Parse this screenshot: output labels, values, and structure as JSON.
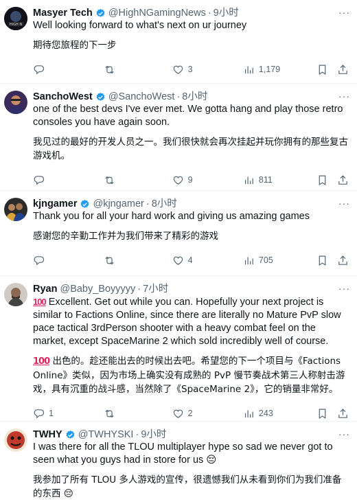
{
  "accent": "#1d9bf0",
  "tweets": [
    {
      "name": "Masyer Tech",
      "verified": true,
      "handle": "@HighNGamingNews",
      "time": "9小时",
      "text": "Well looking forward to what's next on ur journey",
      "translation": "期待您旅程的下一步",
      "replies": "",
      "retweets": "",
      "likes": "3",
      "views": "1,179"
    },
    {
      "name": "SanchoWest",
      "verified": true,
      "handle": "@SanchoWest",
      "time": "8小时",
      "text": "one of the best devs I've ever met. We gotta hang and play those retro consoles you have again soon.",
      "translation": "我见过的最好的开发人员之一。我们很快就会再次挂起并玩你拥有的那些复古游戏机。",
      "replies": "",
      "retweets": "",
      "likes": "9",
      "views": "811"
    },
    {
      "name": "kjngamer",
      "verified": true,
      "handle": "@kjngamer",
      "time": "8小时",
      "text": "Thank you for all your hard work and giving us amazing games",
      "translation": "感谢您的辛勤工作并为我们带来了精彩的游戏",
      "replies": "",
      "retweets": "",
      "likes": "4",
      "views": "705"
    },
    {
      "name": "Ryan",
      "verified": false,
      "handle": "@Baby_Boyyyyy",
      "time": "7小时",
      "emoji": "100",
      "text": "Excellent. Get out while you can. Hopefully your next project is similar to Factions Online, since there are literally no Mature PvP slow pace tactical 3rdPerson shooter with a heavy combat feel on the market, except SpaceMarine 2 which sold incredibly well of course.",
      "translation": "出色的。趁还能出去的时候出去吧。希望您的下一个项目与《Factions Online》类似，因为市场上确实没有成熟的 PvP 慢节奏战术第三人称射击游戏，具有沉重的战斗感，当然除了《SpaceMarine 2》，它的销量非常好。",
      "replies": "1",
      "retweets": "",
      "likes": "2",
      "views": "243"
    },
    {
      "name": "TWHY",
      "verified": true,
      "handle": "@TWHYSKI",
      "time": "9小时",
      "text": "I was there for all the TLOU multiplayer hype so sad we never got to seen what you guys had in store for us 😔",
      "translation": "我参加了所有 TLOU 多人游戏的宣传，很遗憾我们从未看到你们为我们准备的东西 😔"
    }
  ],
  "dot": "·",
  "more": "···"
}
